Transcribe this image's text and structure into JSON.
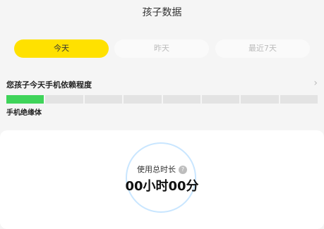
{
  "header": {
    "title": "孩子数据"
  },
  "tabs": [
    {
      "label": "今天",
      "active": true
    },
    {
      "label": "昨天",
      "active": false
    },
    {
      "label": "最近7天",
      "active": false
    }
  ],
  "dependency": {
    "title": "您孩子今天手机依赖程度",
    "level_label": "手机绝缘体",
    "segments_total": 8,
    "segments_filled": 1,
    "fill_color": "#3fd45a"
  },
  "usage": {
    "label": "使用总时长",
    "help_icon": "?",
    "value": "00小时00分"
  },
  "colors": {
    "accent": "#ffe100",
    "ring": "#c9e6ff"
  }
}
